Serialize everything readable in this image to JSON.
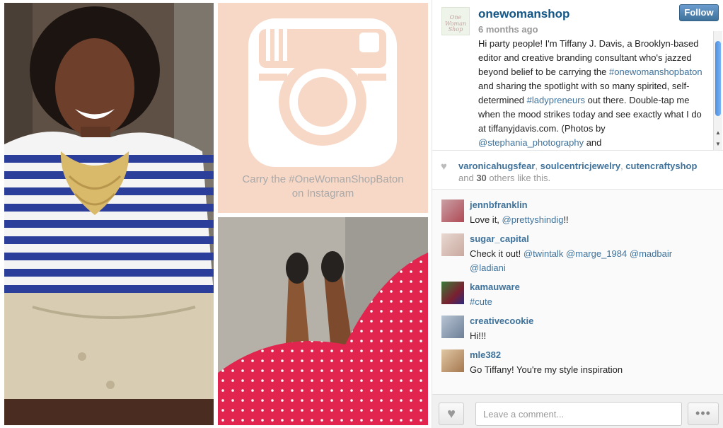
{
  "post": {
    "username": "onewomanshop",
    "time": "6 months ago",
    "follow_label": "Follow",
    "caption_parts": [
      "Hi party people! I'm Tiffany J. Davis, a Brooklyn-based editor and creative branding consultant who's jazzed beyond belief to be carrying the ",
      "#onewomanshopbaton",
      " and sharing the spotlight with so many spirited, self-determined ",
      "#ladypreneurs",
      " out there. Double-tap me when the mood strikes today and see exactly what I do at tiffanyjdavis.com. (Photos by ",
      "@stephania_photography",
      " and"
    ],
    "logo_caption": [
      "Carry the #OneWomanShopBaton",
      "on Instagram"
    ]
  },
  "likes": {
    "likers": [
      "varonicahugsfear",
      "soulcentricjewelry",
      "cutencraftyshop"
    ],
    "others_prefix": "and ",
    "others_count": "30",
    "others_suffix": " others like this."
  },
  "comments": [
    {
      "user": "jennbfranklin",
      "parts": [
        "Love it, ",
        "@prettyshindig",
        "!!"
      ],
      "avatar_color": "#b04a55"
    },
    {
      "user": "sugar_capital",
      "parts": [
        "Check it out! ",
        "@twintalk",
        " ",
        "@marge_1984",
        " ",
        "@madbair",
        " ",
        "@ladiani"
      ],
      "avatar_color": "#c9a9a0"
    },
    {
      "user": "kamauware",
      "parts": [
        "",
        "#cute"
      ],
      "avatar_color": "#7a2030"
    },
    {
      "user": "creativecookie",
      "parts": [
        "Hi!!!"
      ],
      "avatar_color": "#6d7f96"
    },
    {
      "user": "mle382",
      "parts": [
        "Go Tiffany! You're my style inspiration"
      ],
      "avatar_color": "#a5774e"
    }
  ],
  "footer": {
    "comment_placeholder": "Leave a comment...",
    "more_label": "•••"
  },
  "colors": {
    "link": "#3f729b",
    "username": "#125688",
    "logo_bg": "#f7d8c6",
    "stripe_blue": "#2b3f9a",
    "dress_red": "#e2254e"
  },
  "icons": {
    "like": "heart-icon",
    "more": "ellipsis-icon"
  }
}
